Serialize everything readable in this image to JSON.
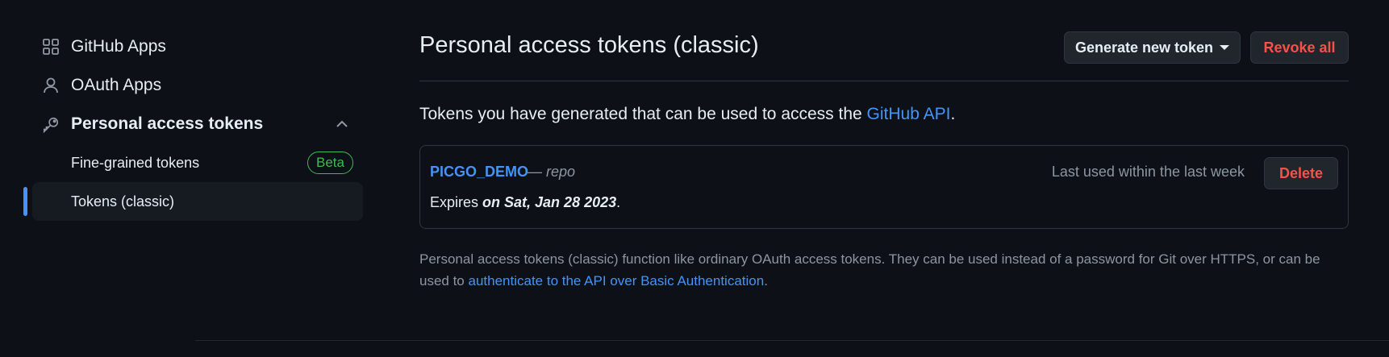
{
  "sidebar": {
    "items": [
      {
        "label": "GitHub Apps",
        "icon": "apps-grid-icon"
      },
      {
        "label": "OAuth Apps",
        "icon": "person-icon"
      },
      {
        "label": "Personal access tokens",
        "icon": "key-icon",
        "expanded": true
      }
    ],
    "sub_items": [
      {
        "label": "Fine-grained tokens",
        "badge": "Beta"
      },
      {
        "label": "Tokens (classic)",
        "active": true
      }
    ]
  },
  "header": {
    "title": "Personal access tokens (classic)",
    "generate_label": "Generate new token",
    "revoke_label": "Revoke all"
  },
  "intro": {
    "text": "Tokens you have generated that can be used to access the ",
    "link": "GitHub API",
    "suffix": "."
  },
  "token": {
    "name": "PICGO_DEMO",
    "scope": "— repo",
    "expires_prefix": "Expires ",
    "expires_date": "on Sat, Jan 28 2023",
    "expires_suffix": ".",
    "last_used": "Last used within the last week",
    "delete_label": "Delete"
  },
  "note": {
    "text": "Personal access tokens (classic) function like ordinary OAuth access tokens. They can be used instead of a password for Git over HTTPS, or can be used to ",
    "link": "authenticate to the API over Basic Authentication",
    "suffix": "."
  },
  "colors": {
    "background": "#0d1117",
    "accent": "#4493f8",
    "danger": "#f85149",
    "success": "#3fb950",
    "muted": "#8d96a0"
  }
}
